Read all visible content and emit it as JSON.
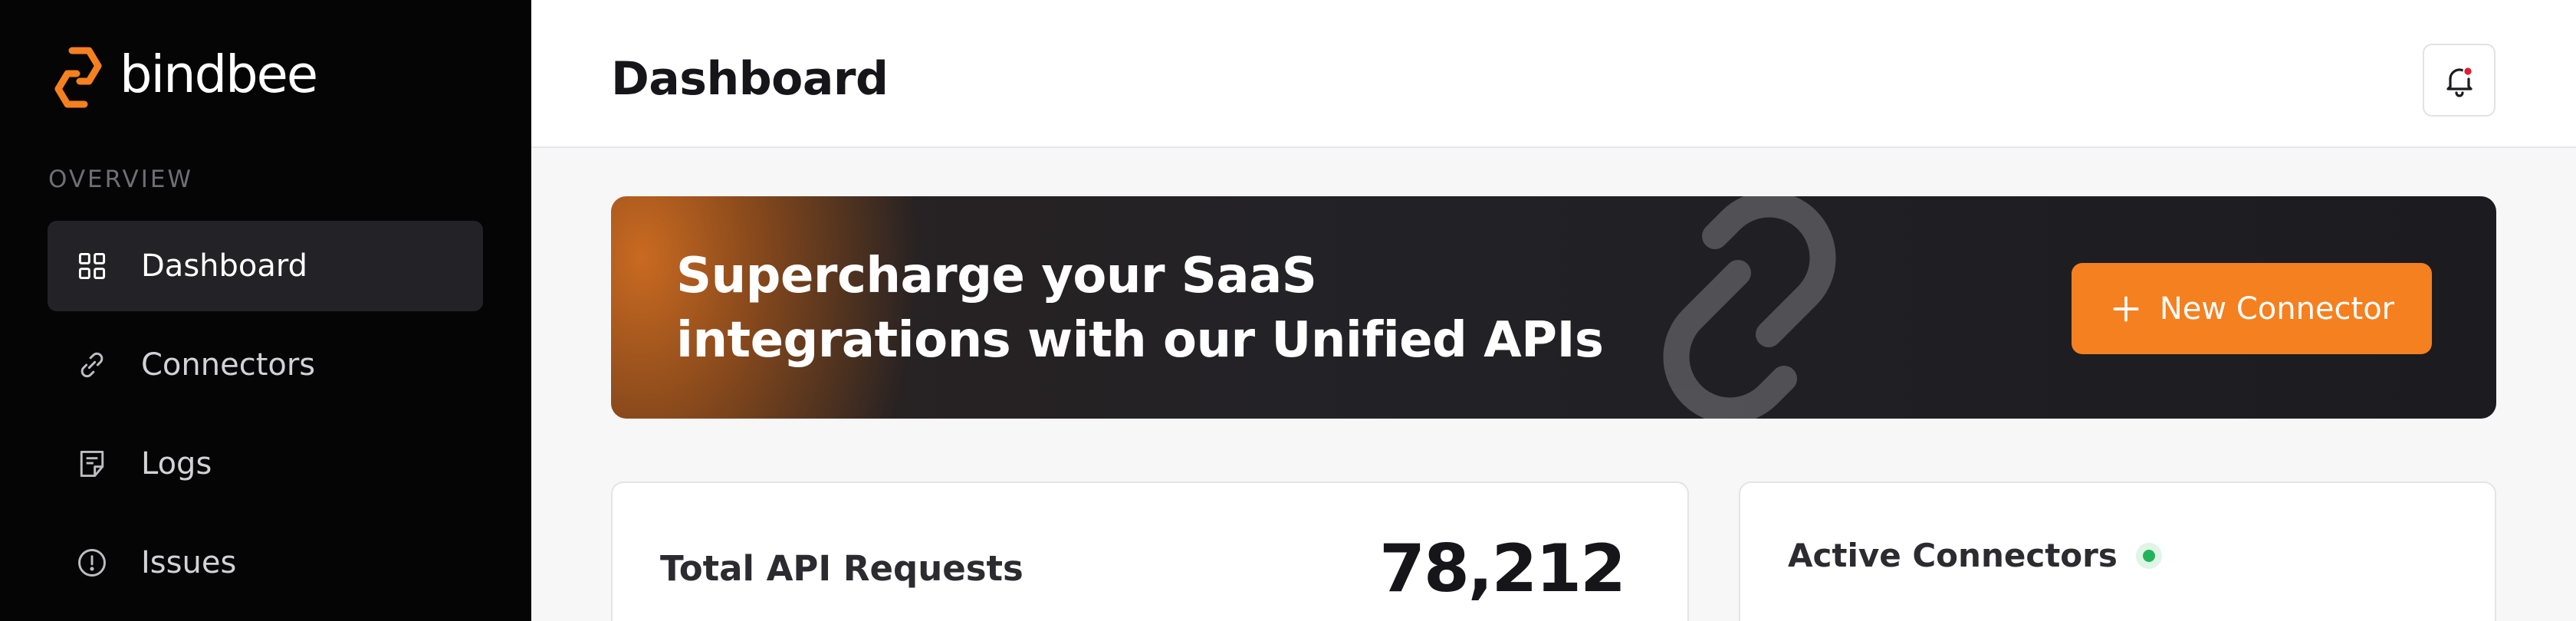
{
  "brand": {
    "name": "bindbee",
    "accent": "#f58020"
  },
  "sidebar": {
    "section_label": "OVERVIEW",
    "items": [
      {
        "label": "Dashboard",
        "icon": "grid-icon",
        "active": true
      },
      {
        "label": "Connectors",
        "icon": "link-icon",
        "active": false
      },
      {
        "label": "Logs",
        "icon": "document-icon",
        "active": false
      },
      {
        "label": "Issues",
        "icon": "alert-circle-icon",
        "active": false
      }
    ]
  },
  "header": {
    "title": "Dashboard",
    "notification_icon": "bell-icon",
    "has_unread": true
  },
  "banner": {
    "line1": "Supercharge your SaaS",
    "line2": "integrations with our Unified APIs",
    "button_label": "New Connector",
    "button_icon": "plus-icon"
  },
  "stats": {
    "total_api_requests": {
      "label": "Total API Requests",
      "value": "78,212"
    },
    "active_connectors": {
      "label": "Active Connectors",
      "status_color": "#22b45a"
    }
  }
}
